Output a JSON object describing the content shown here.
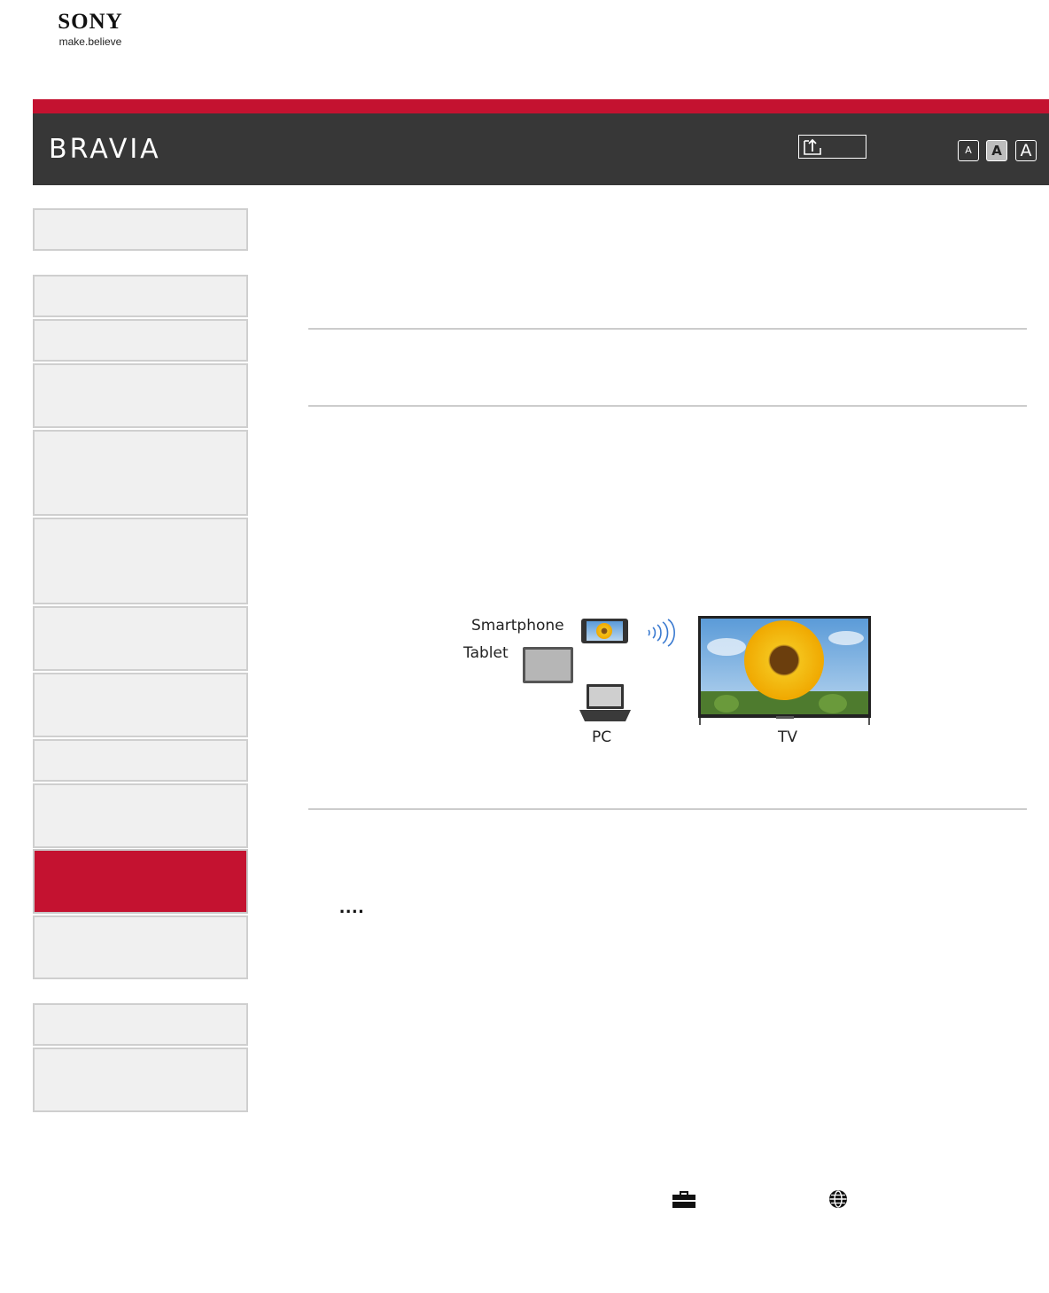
{
  "brand": {
    "logo_text": "SONY",
    "tagline": "make.believe",
    "accent_color": "#c41230",
    "header_color": "#373737"
  },
  "header": {
    "product_name": "BRAVIA",
    "font_size_buttons": [
      "A",
      "A",
      "A"
    ],
    "selected_font_size": "medium"
  },
  "sidebar": {
    "active_index": 11,
    "item_count": 15
  },
  "figure": {
    "labels": {
      "smartphone": "Smartphone",
      "tablet": "Tablet",
      "pc": "PC",
      "tv": "TV"
    }
  },
  "content": {
    "dots": "...."
  },
  "icons": [
    "share-icon",
    "smartphone-icon",
    "wireless-signal-icon",
    "tablet-icon",
    "laptop-icon",
    "tv-icon",
    "toolbox-icon",
    "globe-icon"
  ]
}
